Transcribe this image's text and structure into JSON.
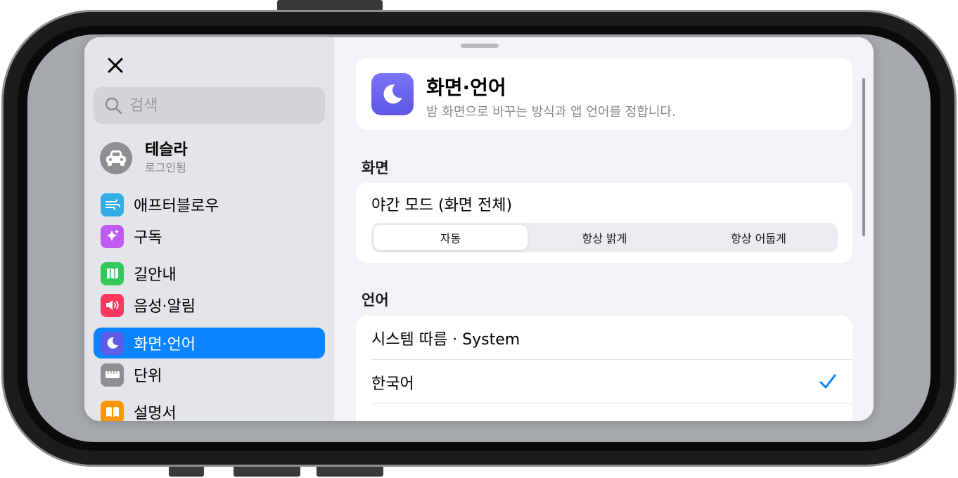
{
  "sidebar": {
    "search_placeholder": "검색",
    "profile": {
      "name": "테슬라",
      "status": "로그인됨"
    },
    "items": [
      {
        "label": "애프터블로우",
        "icon": "airflow-icon",
        "color": "#32ade6"
      },
      {
        "label": "구독",
        "icon": "sparkles-icon",
        "color": "#bf5af2"
      },
      {
        "label": "길안내",
        "icon": "map-icon",
        "color": "#34c759"
      },
      {
        "label": "음성·알림",
        "icon": "speaker-icon",
        "color": "#ff375f"
      },
      {
        "label": "화면·언어",
        "icon": "moon-icon",
        "color": "#5e5ce6",
        "active": true
      },
      {
        "label": "단위",
        "icon": "ruler-icon",
        "color": "#8e8e93"
      },
      {
        "label": "설명서",
        "icon": "book-icon",
        "color": "#ff9500"
      }
    ]
  },
  "header": {
    "title": "화면·언어",
    "subtitle": "밤 화면으로 바꾸는 방식과 앱 언어를 정합니다."
  },
  "display_section": {
    "label": "화면",
    "night_mode_title": "야간 모드 (화면 전체)",
    "options": [
      "자동",
      "항상 밝게",
      "항상 어둡게"
    ],
    "selected": "자동"
  },
  "language_section": {
    "label": "언어",
    "options": [
      "시스템 따름 · System",
      "한국어"
    ],
    "selected": "한국어"
  },
  "colors": {
    "accent": "#0a84ff",
    "sidebar_bg": "#e4e5e9",
    "content_bg": "#f2f2f7"
  }
}
